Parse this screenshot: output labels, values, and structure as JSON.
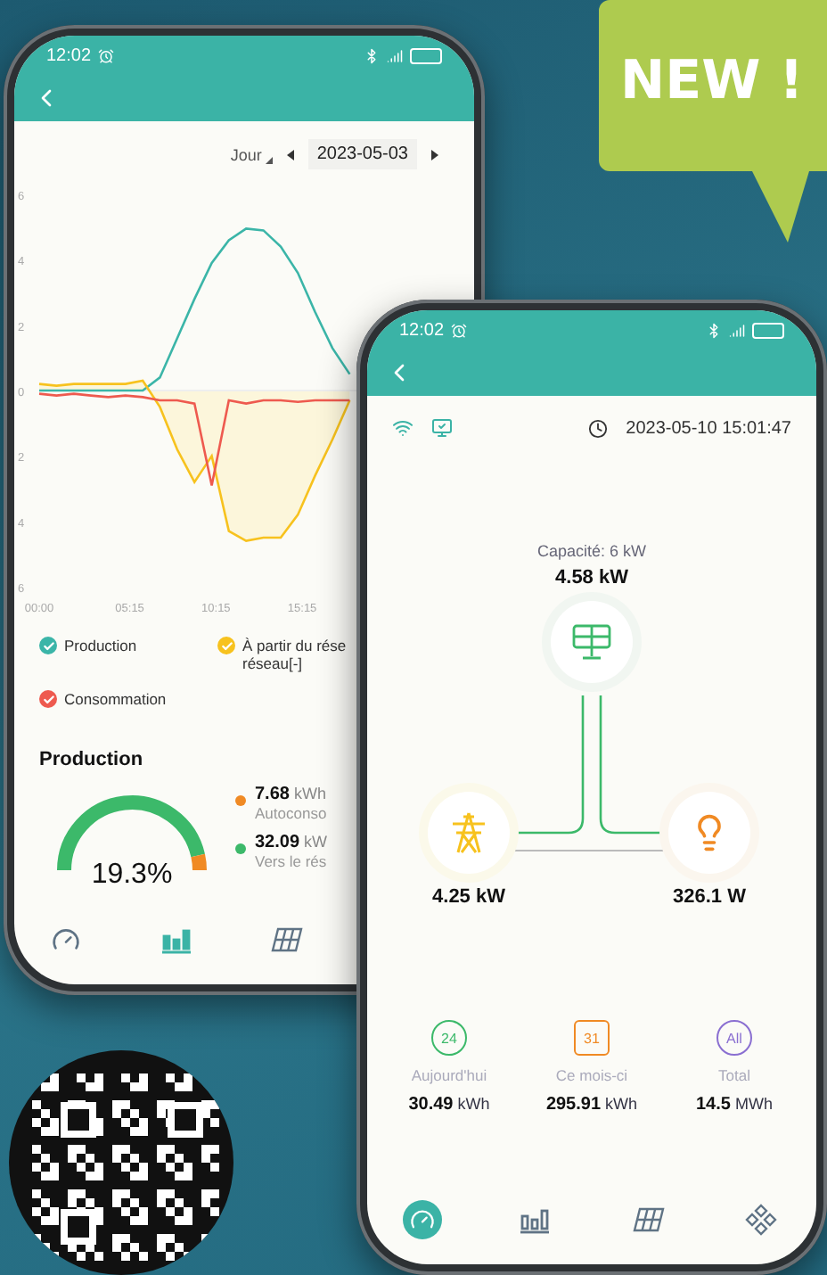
{
  "badge": {
    "text": "NEW !"
  },
  "history_phone": {
    "status_bar": {
      "time": "12:02"
    },
    "period": {
      "label": "Jour"
    },
    "date": "2023-05-03",
    "chart_data": {
      "type": "line",
      "x": [
        0,
        1,
        2,
        3,
        4,
        5,
        6,
        7,
        8,
        9,
        10,
        11,
        12,
        13,
        14,
        15,
        16,
        17,
        18
      ],
      "xlim": [
        0,
        18.5
      ],
      "ylim": [
        -6,
        6
      ],
      "xticks": [
        {
          "value": 0,
          "label": "00:00"
        },
        {
          "value": 5.25,
          "label": "05:15"
        },
        {
          "value": 10.25,
          "label": "10:15"
        },
        {
          "value": 15.25,
          "label": "15:15"
        }
      ],
      "yticks": [
        {
          "value": 6,
          "label": "6"
        },
        {
          "value": 4,
          "label": "4"
        },
        {
          "value": 2,
          "label": "2"
        },
        {
          "value": 0,
          "label": "0"
        },
        {
          "value": -2,
          "label": "2"
        },
        {
          "value": -4,
          "label": "4"
        },
        {
          "value": -6,
          "label": "6"
        }
      ],
      "series": [
        {
          "color": "#3bb5a8",
          "values": [
            0,
            0,
            0,
            0,
            0,
            0,
            0,
            0.4,
            1.6,
            2.8,
            3.9,
            4.6,
            4.95,
            4.9,
            4.4,
            3.6,
            2.4,
            1.3,
            0.5
          ]
        },
        {
          "color": "#f7c21e",
          "values": [
            0.2,
            0.15,
            0.2,
            0.2,
            0.2,
            0.2,
            0.3,
            -0.5,
            -1.8,
            -2.8,
            -2.0,
            -4.3,
            -4.6,
            -4.5,
            -4.5,
            -3.8,
            -2.6,
            -1.5,
            -0.3
          ]
        },
        {
          "color": "#ee5a4f",
          "values": [
            -0.1,
            -0.15,
            -0.1,
            -0.15,
            -0.2,
            -0.15,
            -0.2,
            -0.3,
            -0.3,
            -0.4,
            -2.9,
            -0.3,
            -0.4,
            -0.3,
            -0.3,
            -0.35,
            -0.3,
            -0.3,
            -0.3
          ]
        }
      ]
    },
    "legend": [
      {
        "lines": [
          "Production"
        ],
        "color": "#3bb5a8"
      },
      {
        "lines": [
          "À partir du rése",
          "réseau[-]"
        ],
        "color": "#f7c21e"
      },
      {
        "lines": [
          "Consommation"
        ],
        "color": "#ee5a4f"
      }
    ],
    "production": {
      "title": "Production",
      "gauge": {
        "reading": "19.3%"
      },
      "stats": [
        {
          "value": "7.68",
          "unit": "kWh",
          "label": "Autoconso",
          "color": "#f08a24"
        },
        {
          "value": "32.09",
          "unit": "kW",
          "label": "Vers le rés",
          "color": "#3cb96a"
        }
      ]
    },
    "nav": [
      {
        "kind": "gauge",
        "selected": false
      },
      {
        "kind": "bars",
        "selected": true
      },
      {
        "kind": "panel",
        "selected": false
      }
    ]
  },
  "overview_phone": {
    "status_bar": {
      "time": "12:02"
    },
    "timestamp": "2023-05-10 15:01:47",
    "capacity": "Capacité: 6 kW",
    "solar_power": "4.58 kW",
    "grid_power": "4.25 kW",
    "load_power": "326.1 W",
    "summary": [
      {
        "badge": "24",
        "label": "Aujourd'hui",
        "value": "30.49",
        "unit": "kWh",
        "color": "#3cb96a"
      },
      {
        "badge": "31",
        "label": "Ce mois-ci",
        "value": "295.91",
        "unit": "kWh",
        "color": "#f08a24"
      },
      {
        "badge": "All",
        "label": "Total",
        "value": "14.5",
        "unit": "MWh",
        "color": "#8a6fd1"
      }
    ],
    "nav": [
      {
        "kind": "gauge",
        "selected": true
      },
      {
        "kind": "bars",
        "selected": false
      },
      {
        "kind": "panel",
        "selected": false
      },
      {
        "kind": "modules",
        "selected": false
      }
    ]
  }
}
